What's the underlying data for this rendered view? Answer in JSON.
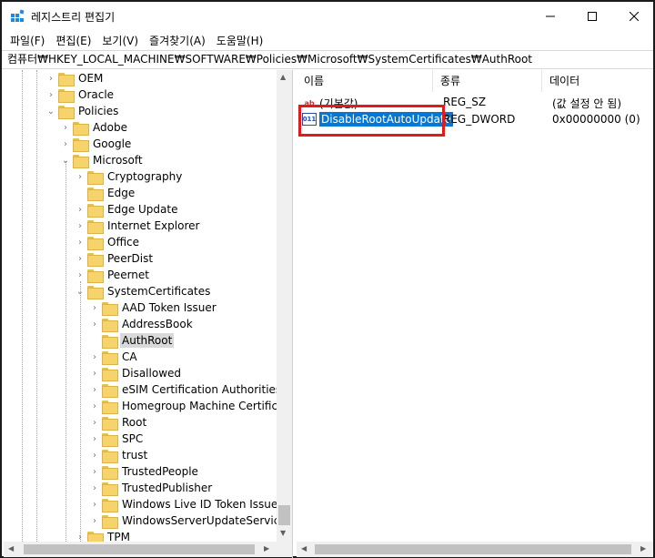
{
  "window": {
    "title": "레지스트리 편집기",
    "controls": {
      "minimize": "—",
      "maximize": "☐",
      "close": "✕"
    }
  },
  "menu": [
    "파일(F)",
    "편집(E)",
    "보기(V)",
    "즐겨찾기(A)",
    "도움말(H)"
  ],
  "address": "컴퓨터₩HKEY_LOCAL_MACHINE₩SOFTWARE₩Policies₩Microsoft₩SystemCertificates₩AuthRoot",
  "tree": {
    "nodes": [
      {
        "label": "OEM",
        "expander": "›"
      },
      {
        "label": "Oracle",
        "expander": "›"
      },
      {
        "label": "Policies",
        "expander": "⌄"
      },
      {
        "label": "Adobe",
        "expander": "›"
      },
      {
        "label": "Google",
        "expander": "›"
      },
      {
        "label": "Microsoft",
        "expander": "⌄"
      },
      {
        "label": "Cryptography",
        "expander": "›"
      },
      {
        "label": "Edge",
        "expander": ""
      },
      {
        "label": "Edge Update",
        "expander": "›"
      },
      {
        "label": "Internet Explorer",
        "expander": "›"
      },
      {
        "label": "Office",
        "expander": "›"
      },
      {
        "label": "PeerDist",
        "expander": "›"
      },
      {
        "label": "Peernet",
        "expander": "›"
      },
      {
        "label": "SystemCertificates",
        "expander": "⌄"
      },
      {
        "label": "AAD Token Issuer",
        "expander": "›"
      },
      {
        "label": "AddressBook",
        "expander": "›"
      },
      {
        "label": "AuthRoot",
        "expander": "",
        "selected": true
      },
      {
        "label": "CA",
        "expander": "›"
      },
      {
        "label": "Disallowed",
        "expander": "›"
      },
      {
        "label": "eSIM Certification Authorities",
        "expander": "›"
      },
      {
        "label": "Homegroup Machine Certificates",
        "expander": "›"
      },
      {
        "label": "Root",
        "expander": "›"
      },
      {
        "label": "SPC",
        "expander": "›"
      },
      {
        "label": "trust",
        "expander": "›"
      },
      {
        "label": "TrustedPeople",
        "expander": "›"
      },
      {
        "label": "TrustedPublisher",
        "expander": "›"
      },
      {
        "label": "Windows Live ID Token Issuer",
        "expander": "›"
      },
      {
        "label": "WindowsServerUpdateServices",
        "expander": "›"
      },
      {
        "label": "TPM",
        "expander": "›"
      }
    ]
  },
  "list": {
    "columns": {
      "name": "이름",
      "type": "종류",
      "data": "데이터"
    },
    "rows": [
      {
        "icon": "ab",
        "name": "(기본값)",
        "type": "REG_SZ",
        "data": "(값 설정 안 됨)",
        "selected": false
      },
      {
        "icon": "011",
        "name": "DisableRootAutoUpdate",
        "type": "REG_DWORD",
        "data": "0x00000000 (0)",
        "selected": true
      }
    ]
  },
  "colors": {
    "selection": "#0078d7",
    "highlight_box": "#e01b1b",
    "folder": "#f6d46b"
  },
  "scroll_arrows": {
    "up": "▲",
    "down": "▼",
    "left": "◀",
    "right": "▶"
  }
}
